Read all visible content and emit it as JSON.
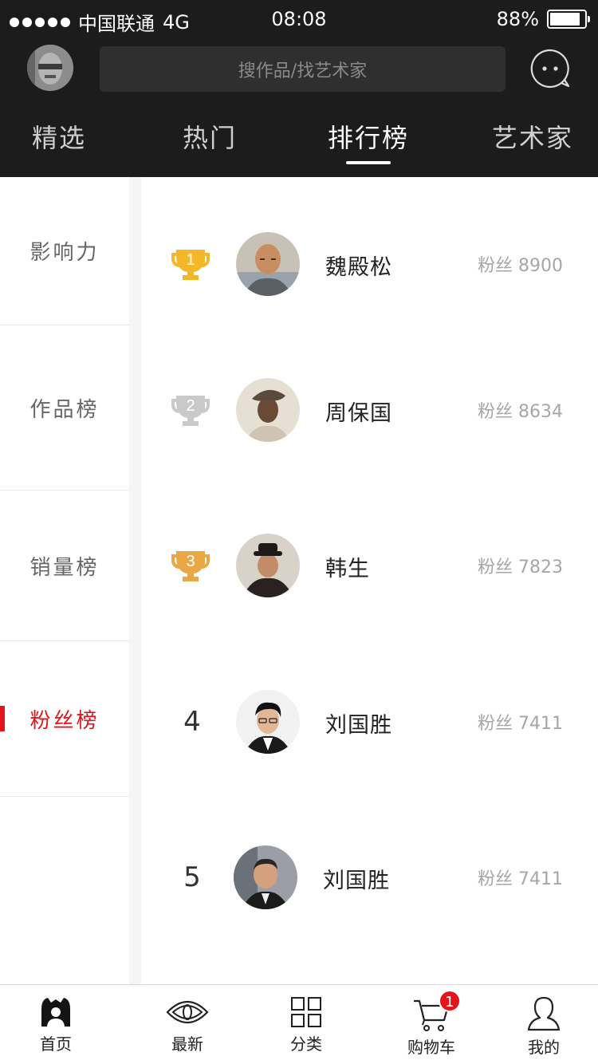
{
  "status_bar": {
    "carrier": "中国联通",
    "network": "4G",
    "time": "08:08",
    "battery": "88%",
    "battery_level": 0.88
  },
  "header": {
    "search_placeholder": "搜作品/找艺术家",
    "tabs": [
      {
        "label": "精选",
        "active": false
      },
      {
        "label": "热门",
        "active": false
      },
      {
        "label": "排行榜",
        "active": true
      },
      {
        "label": "艺术家",
        "active": false
      }
    ]
  },
  "sidebar": {
    "items": [
      {
        "label": "影响力",
        "active": false
      },
      {
        "label": "作品榜",
        "active": false
      },
      {
        "label": "销量榜",
        "active": false
      },
      {
        "label": "粉丝榜",
        "active": true
      }
    ]
  },
  "ranking": [
    {
      "rank": "1",
      "name": "魏殿松",
      "fans": "粉丝 8900",
      "trophy_color": "#f5b72a"
    },
    {
      "rank": "2",
      "name": "周保国",
      "fans": "粉丝 8634",
      "trophy_color": "#c9c9c9"
    },
    {
      "rank": "3",
      "name": "韩生",
      "fans": "粉丝 7823",
      "trophy_color": "#e9a845"
    },
    {
      "rank": "4",
      "name": "刘国胜",
      "fans": "粉丝 7411"
    },
    {
      "rank": "5",
      "name": "刘国胜",
      "fans": "粉丝 7411"
    }
  ],
  "bottom_nav": {
    "items": [
      {
        "label": "首页",
        "icon": "home-icon",
        "active": true
      },
      {
        "label": "最新",
        "icon": "eye-icon",
        "active": false
      },
      {
        "label": "分类",
        "icon": "grid-icon",
        "active": false
      },
      {
        "label": "购物车",
        "icon": "cart-icon",
        "active": false,
        "badge": "1"
      },
      {
        "label": "我的",
        "icon": "user-icon",
        "active": false
      }
    ]
  },
  "colors": {
    "accent": "#e3141b",
    "header_bg": "#1c1c1c"
  }
}
